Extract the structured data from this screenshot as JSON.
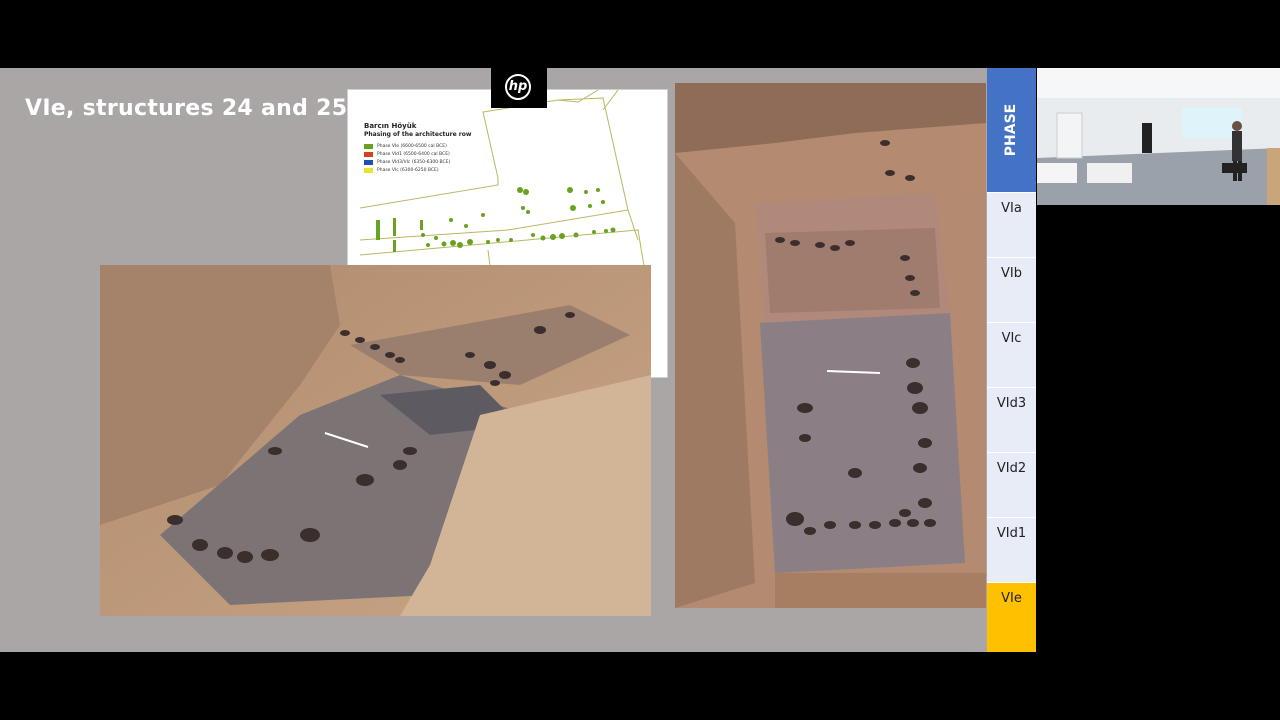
{
  "slide": {
    "title": "VIe, structures 24 and 25"
  },
  "plan": {
    "title": "Barcın Höyük",
    "subtitle": "Phasing of the architecture row",
    "legend": [
      {
        "label": "Phase VIe (6600-6500 cal BCE)",
        "color": "#6aa121"
      },
      {
        "label": "Phase VId1 (6500-6400 cal BCE)",
        "color": "#d6431b"
      },
      {
        "label": "Phase VId3/VIc (6350-6300 BCE)",
        "color": "#1f4fb0"
      },
      {
        "label": "Phase VIc (6300-6250 BCE)",
        "color": "#e8e235"
      }
    ]
  },
  "logo": {
    "text": "hp"
  },
  "phase_bar": {
    "header": "PHASE",
    "phases": [
      "VIa",
      "VIb",
      "VIc",
      "VId3",
      "VId2",
      "VId1",
      "VIe"
    ],
    "active": "VIe",
    "active_color": "#ffc000",
    "header_color": "#4472c4"
  }
}
